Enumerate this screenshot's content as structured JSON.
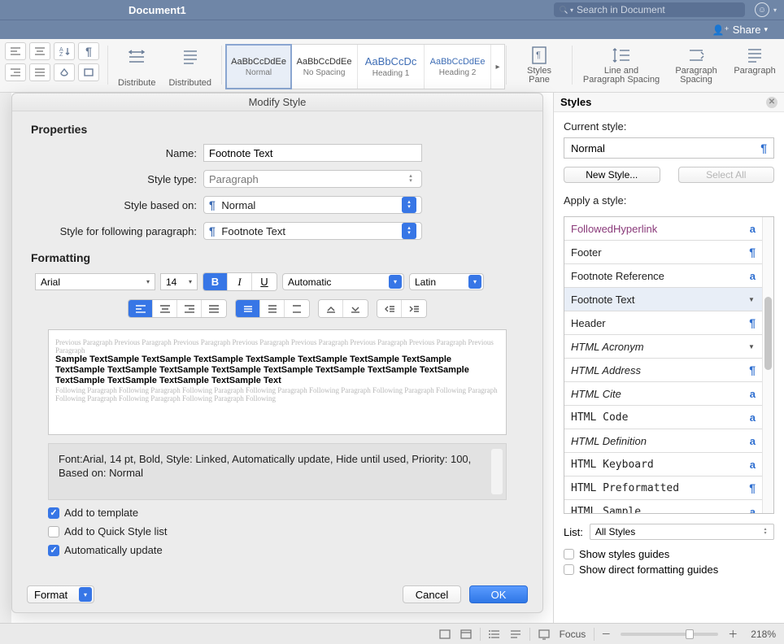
{
  "titlebar": {
    "doc_title": "Document1",
    "search_placeholder": "Search in Document"
  },
  "sharebar": {
    "share": "Share"
  },
  "ribbon": {
    "distribute": "Distribute",
    "distributed": "Distributed",
    "gallery": [
      {
        "preview": "AaBbCcDdEe",
        "name": "Normal"
      },
      {
        "preview": "AaBbCcDdEe",
        "name": "No Spacing"
      },
      {
        "preview": "AaBbCcDc",
        "name": "Heading 1"
      },
      {
        "preview": "AaBbCcDdEe",
        "name": "Heading 2"
      }
    ],
    "styles_pane_l1": "Styles",
    "styles_pane_l2": "Pane",
    "line_spacing_l1": "Line and",
    "line_spacing_l2": "Paragraph Spacing",
    "para_spacing_l1": "Paragraph",
    "para_spacing_l2": "Spacing",
    "paragraph": "Paragraph"
  },
  "dialog": {
    "title": "Modify Style",
    "properties_h": "Properties",
    "name_lab": "Name:",
    "name_val": "Footnote Text",
    "type_lab": "Style type:",
    "type_val": "Paragraph",
    "based_lab": "Style based on:",
    "based_val": "Normal",
    "following_lab": "Style for following paragraph:",
    "following_val": "Footnote Text",
    "formatting_h": "Formatting",
    "font_name": "Arial",
    "font_size": "14",
    "color": "Automatic",
    "script": "Latin",
    "preview_grey1": "Previous Paragraph Previous Paragraph Previous Paragraph Previous Paragraph Previous Paragraph Previous Paragraph Previous Paragraph Previous Paragraph",
    "preview_sample": "Sample TextSample TextSample TextSample TextSample TextSample TextSample TextSample TextSample TextSample TextSample TextSample TextSample TextSample TextSample TextSample TextSample TextSample TextSample TextSample Text",
    "preview_grey2": "Following Paragraph Following Paragraph Following Paragraph Following Paragraph Following Paragraph Following Paragraph Following Paragraph Following Paragraph Following Paragraph Following Paragraph Following",
    "desc": "Font:Arial, 14 pt, Bold, Style: Linked, Automatically update, Hide until used, Priority: 100, Based on: Normal",
    "add_template": "Add to template",
    "add_qsl": "Add to Quick Style list",
    "auto_update": "Automatically update",
    "format_menu": "Format",
    "cancel": "Cancel",
    "ok": "OK"
  },
  "pane": {
    "title": "Styles",
    "current_lab": "Current style:",
    "current_val": "Normal",
    "new_style": "New Style...",
    "select_all": "Select All",
    "apply_lab": "Apply a style:",
    "items": [
      {
        "name": "FollowedHyperlink",
        "mark": "a",
        "color": "#8a3a7a"
      },
      {
        "name": "Footer",
        "mark": "¶",
        "color": "#222"
      },
      {
        "name": "Footnote Reference",
        "mark": "a",
        "color": "#222"
      },
      {
        "name": "Footnote Text",
        "mark": "▾",
        "color": "#222",
        "selected": true
      },
      {
        "name": "Header",
        "mark": "¶",
        "color": "#222"
      },
      {
        "name": "HTML Acronym",
        "mark": "▾",
        "color": "#222",
        "italic": true
      },
      {
        "name": "HTML Address",
        "mark": "¶",
        "color": "#222",
        "italic": true
      },
      {
        "name": "HTML Cite",
        "mark": "a",
        "color": "#222",
        "italic": true
      },
      {
        "name": "HTML Code",
        "mark": "a",
        "color": "#222",
        "mono": true
      },
      {
        "name": "HTML Definition",
        "mark": "a",
        "color": "#222",
        "italic": true
      },
      {
        "name": "HTML Keyboard",
        "mark": "a",
        "color": "#222",
        "mono": true
      },
      {
        "name": "HTML Preformatted",
        "mark": "¶",
        "color": "#222",
        "mono": true
      },
      {
        "name": "HTML Sample",
        "mark": "a",
        "color": "#222",
        "mono": true
      }
    ],
    "list_lab": "List:",
    "list_val": "All Styles",
    "show_guides": "Show styles guides",
    "show_direct": "Show direct formatting guides"
  },
  "statusbar": {
    "focus": "Focus",
    "zoom": "218%"
  }
}
